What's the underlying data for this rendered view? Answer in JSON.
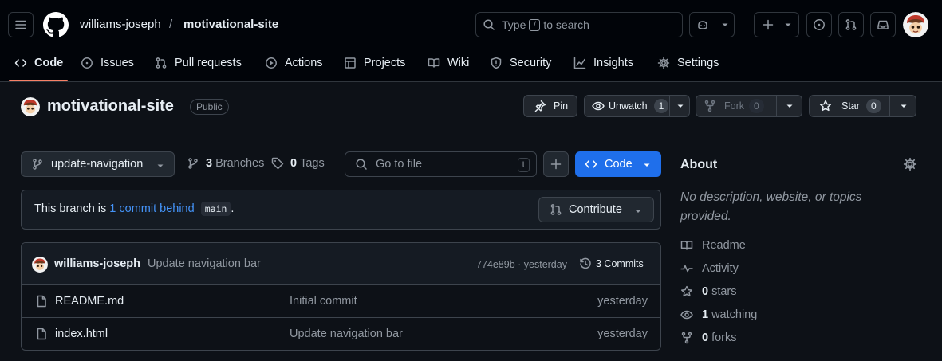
{
  "header": {
    "owner": "williams-joseph",
    "separator": "/",
    "repo": "motivational-site",
    "search": {
      "prefix": "Type",
      "key": "/",
      "suffix": "to search"
    }
  },
  "tabs": [
    {
      "label": "Code",
      "icon": "code-icon",
      "active": true
    },
    {
      "label": "Issues",
      "icon": "issue-icon"
    },
    {
      "label": "Pull requests",
      "icon": "pull-request-icon"
    },
    {
      "label": "Actions",
      "icon": "play-icon"
    },
    {
      "label": "Projects",
      "icon": "table-icon"
    },
    {
      "label": "Wiki",
      "icon": "book-icon"
    },
    {
      "label": "Security",
      "icon": "shield-icon"
    },
    {
      "label": "Insights",
      "icon": "graph-icon"
    },
    {
      "label": "Settings",
      "icon": "gear-icon"
    }
  ],
  "repo": {
    "name": "motivational-site",
    "visibility": "Public",
    "pin_label": "Pin",
    "watch_label": "Unwatch",
    "watch_count": "1",
    "fork_label": "Fork",
    "fork_count": "0",
    "star_label": "Star",
    "star_count": "0"
  },
  "toolbar": {
    "branch": "update-navigation",
    "branches_count": "3",
    "branches_label": "Branches",
    "tags_count": "0",
    "tags_label": "Tags",
    "goto_placeholder": "Go to file",
    "goto_key": "t",
    "code_label": "Code"
  },
  "behind": {
    "prefix": "This branch is",
    "link": "1 commit behind",
    "base": "main",
    "suffix": ".",
    "contribute_label": "Contribute"
  },
  "latest_commit": {
    "author": "williams-joseph",
    "message": "Update navigation bar",
    "meta": "774e89b · yesterday",
    "commits_label": "3 Commits"
  },
  "files": [
    {
      "name": "README.md",
      "message": "Initial commit",
      "time": "yesterday"
    },
    {
      "name": "index.html",
      "message": "Update navigation bar",
      "time": "yesterday"
    }
  ],
  "about": {
    "title": "About",
    "description": "No description, website, or topics provided.",
    "readme": "Readme",
    "activity": "Activity",
    "stars_count": "0",
    "stars_label": "stars",
    "watching_count": "1",
    "watching_label": "watching",
    "forks_count": "0",
    "forks_label": "forks"
  },
  "colors": {
    "background": "#0d1117",
    "header_bg": "#010409",
    "accent_blue": "#1f6feb",
    "link": "#4493f8",
    "tab_underline": "#f78166"
  }
}
